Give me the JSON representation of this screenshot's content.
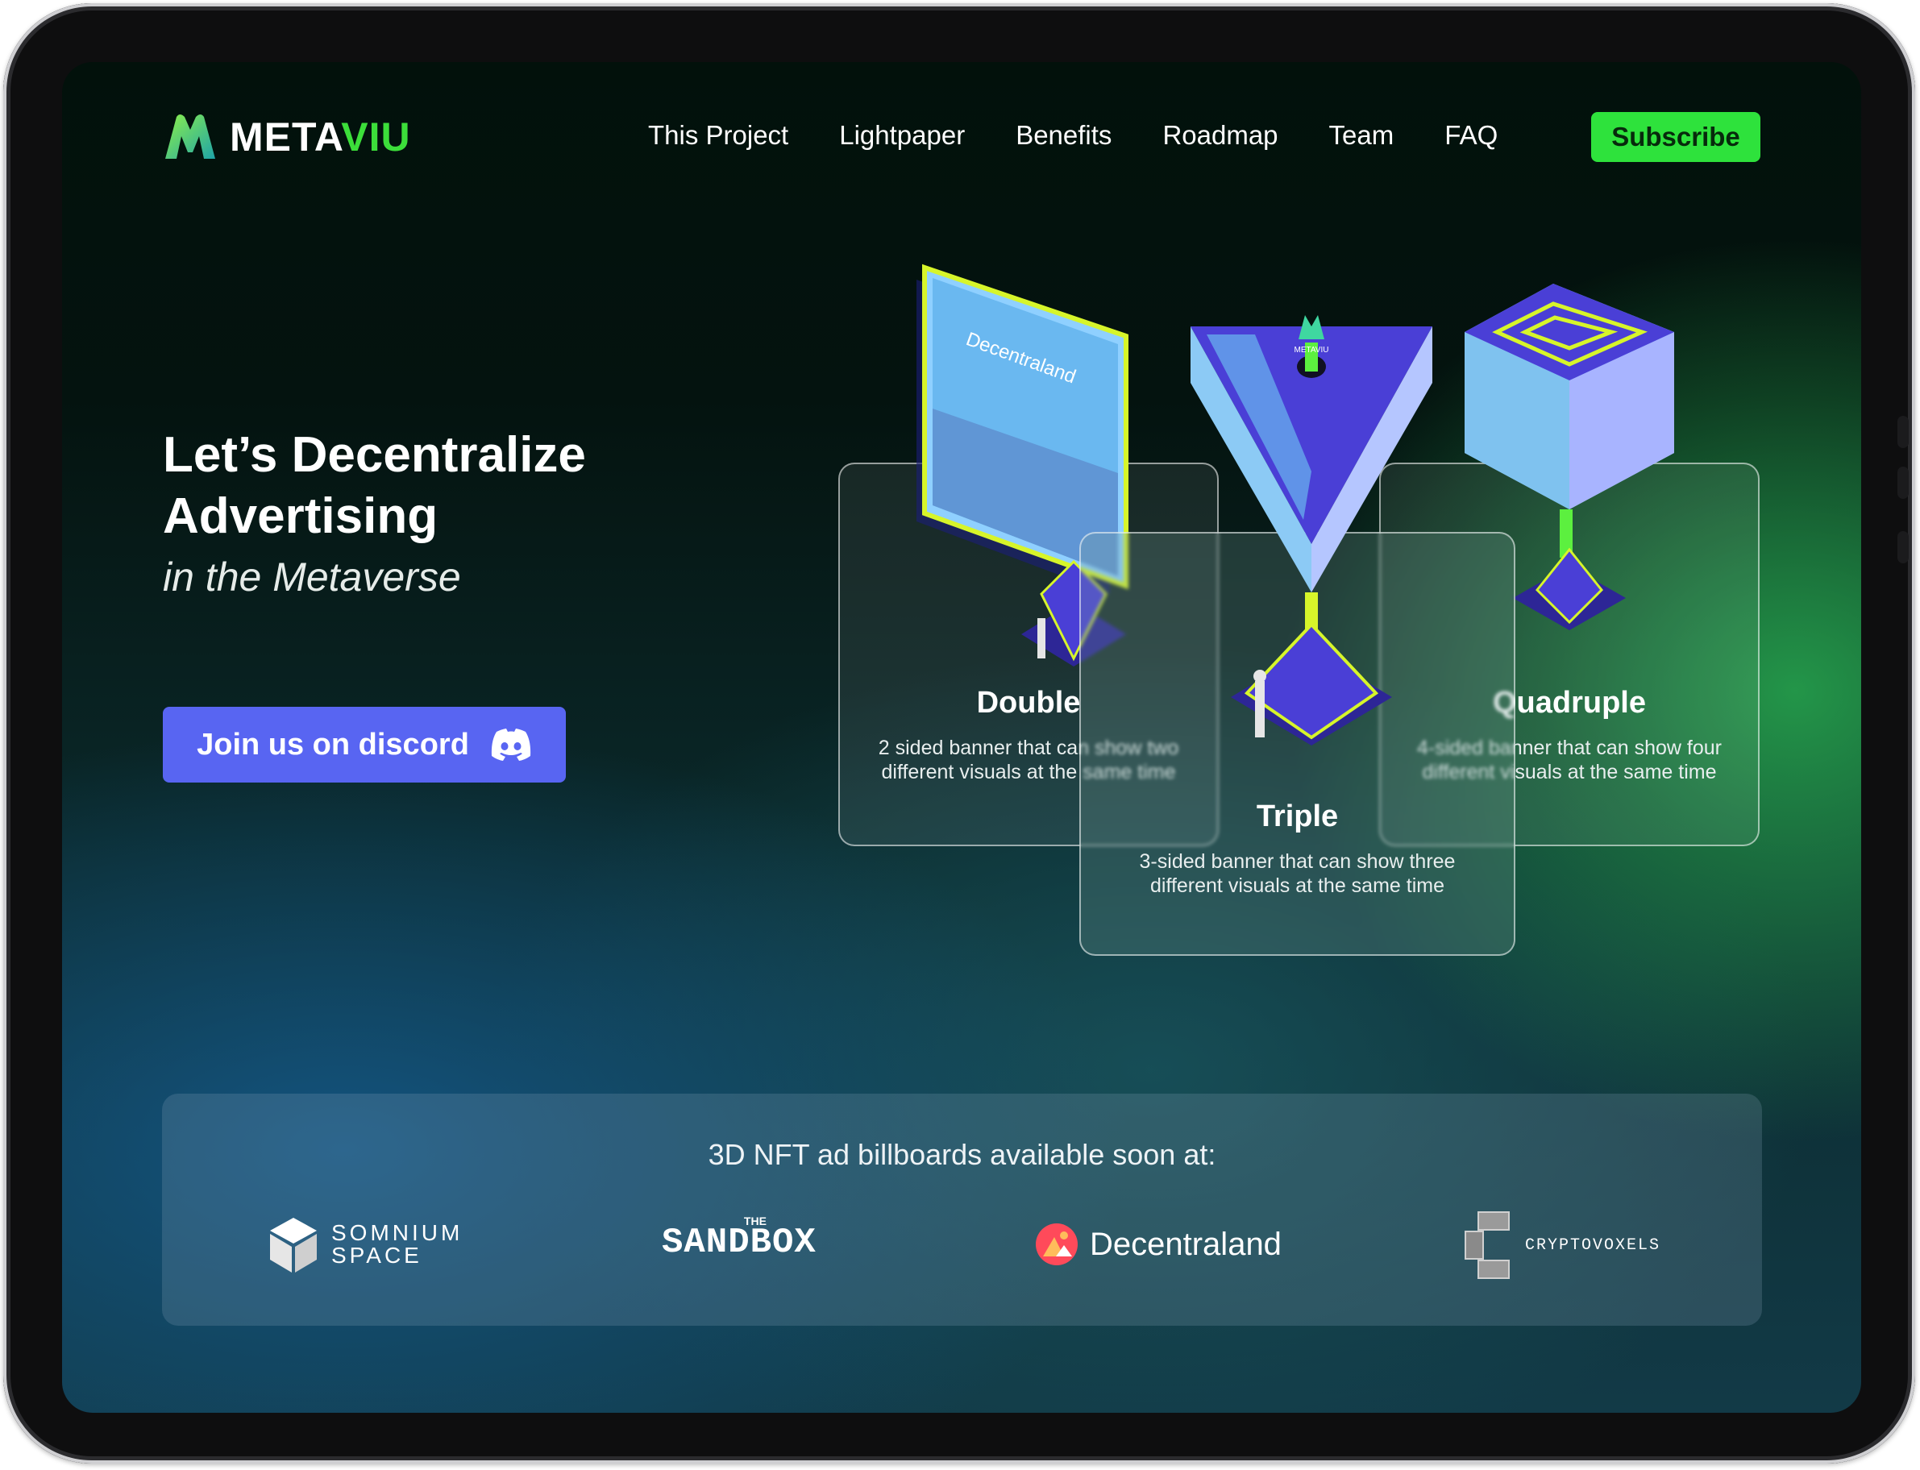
{
  "brand": {
    "name_part1": "META",
    "name_part2": "VIU"
  },
  "nav": {
    "items": [
      "This Project",
      "Lightpaper",
      "Benefits",
      "Roadmap",
      "Team",
      "FAQ"
    ],
    "subscribe_label": "Subscribe"
  },
  "hero": {
    "title": "Let’s Decentralize Advertising",
    "subtitle": "in the Metaverse",
    "discord_label": "Join us on discord"
  },
  "cards": [
    {
      "title": "Double",
      "description": "2 sided banner that can show two different visuals at the same time"
    },
    {
      "title": "Triple",
      "description": "3-sided banner that can show three different visuals at the same time"
    },
    {
      "title": "Quadruple",
      "description": "4-sided banner that can show four different visuals at the same time"
    }
  ],
  "billboard_labels": {
    "screen": "Decentraland",
    "brand": "METAVIU"
  },
  "partners": {
    "title": "3D NFT ad billboards available soon at:",
    "logos": [
      {
        "line1": "SOMNIUM",
        "line2": "SPACE"
      },
      {
        "small": "THE",
        "main": "SANDBOX"
      },
      {
        "main": "Decentraland"
      },
      {
        "main": "CRYPTOVOXELS"
      }
    ]
  },
  "colors": {
    "accent_green": "#2ee23c",
    "discord": "#5865f2",
    "pyramid": "#4a3fd6",
    "neon": "#d7f52a"
  }
}
